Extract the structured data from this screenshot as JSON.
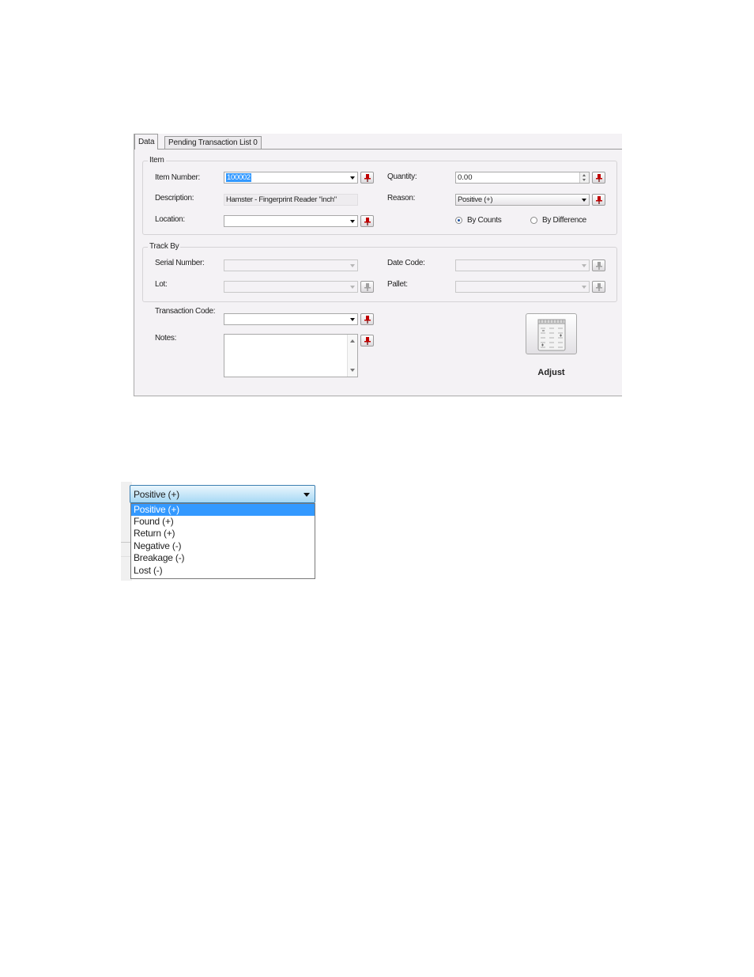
{
  "tabs": [
    {
      "label": "Data"
    },
    {
      "label": "Pending Transaction List  0"
    }
  ],
  "item_group": {
    "legend": "Item",
    "item_number": {
      "label": "Item Number:",
      "value": "100002"
    },
    "description": {
      "label": "Description:",
      "value": "Hamster - Fingerprint Reader \"inch\""
    },
    "location": {
      "label": "Location:",
      "value": ""
    },
    "quantity": {
      "label": "Quantity:",
      "value": "0.00"
    },
    "reason": {
      "label": "Reason:",
      "value": "Positive (+)"
    },
    "by_counts": {
      "label": "By Counts",
      "selected": true
    },
    "by_difference": {
      "label": "By Difference",
      "selected": false
    }
  },
  "track_group": {
    "legend": "Track By",
    "serial_number": {
      "label": "Serial Number:",
      "value": ""
    },
    "lot": {
      "label": "Lot:",
      "value": ""
    },
    "date_code": {
      "label": "Date Code:",
      "value": ""
    },
    "pallet": {
      "label": "Pallet:",
      "value": ""
    }
  },
  "transaction_code": {
    "label": "Transaction Code:",
    "value": ""
  },
  "notes": {
    "label": "Notes:",
    "value": ""
  },
  "adjust_button": {
    "label": "Adjust",
    "icon": "calculator-sheet-icon"
  },
  "reason_dropdown": {
    "selected": "Positive (+)",
    "options": [
      "Positive (+)",
      "Found (+)",
      "Return (+)",
      "Negative (-)",
      "Breakage (-)",
      "Lost (-)"
    ],
    "highlighted_index": 0
  },
  "colors": {
    "pin_active": "#c00000",
    "pin_disabled": "#a0a0a0",
    "selection": "#3399ff"
  }
}
